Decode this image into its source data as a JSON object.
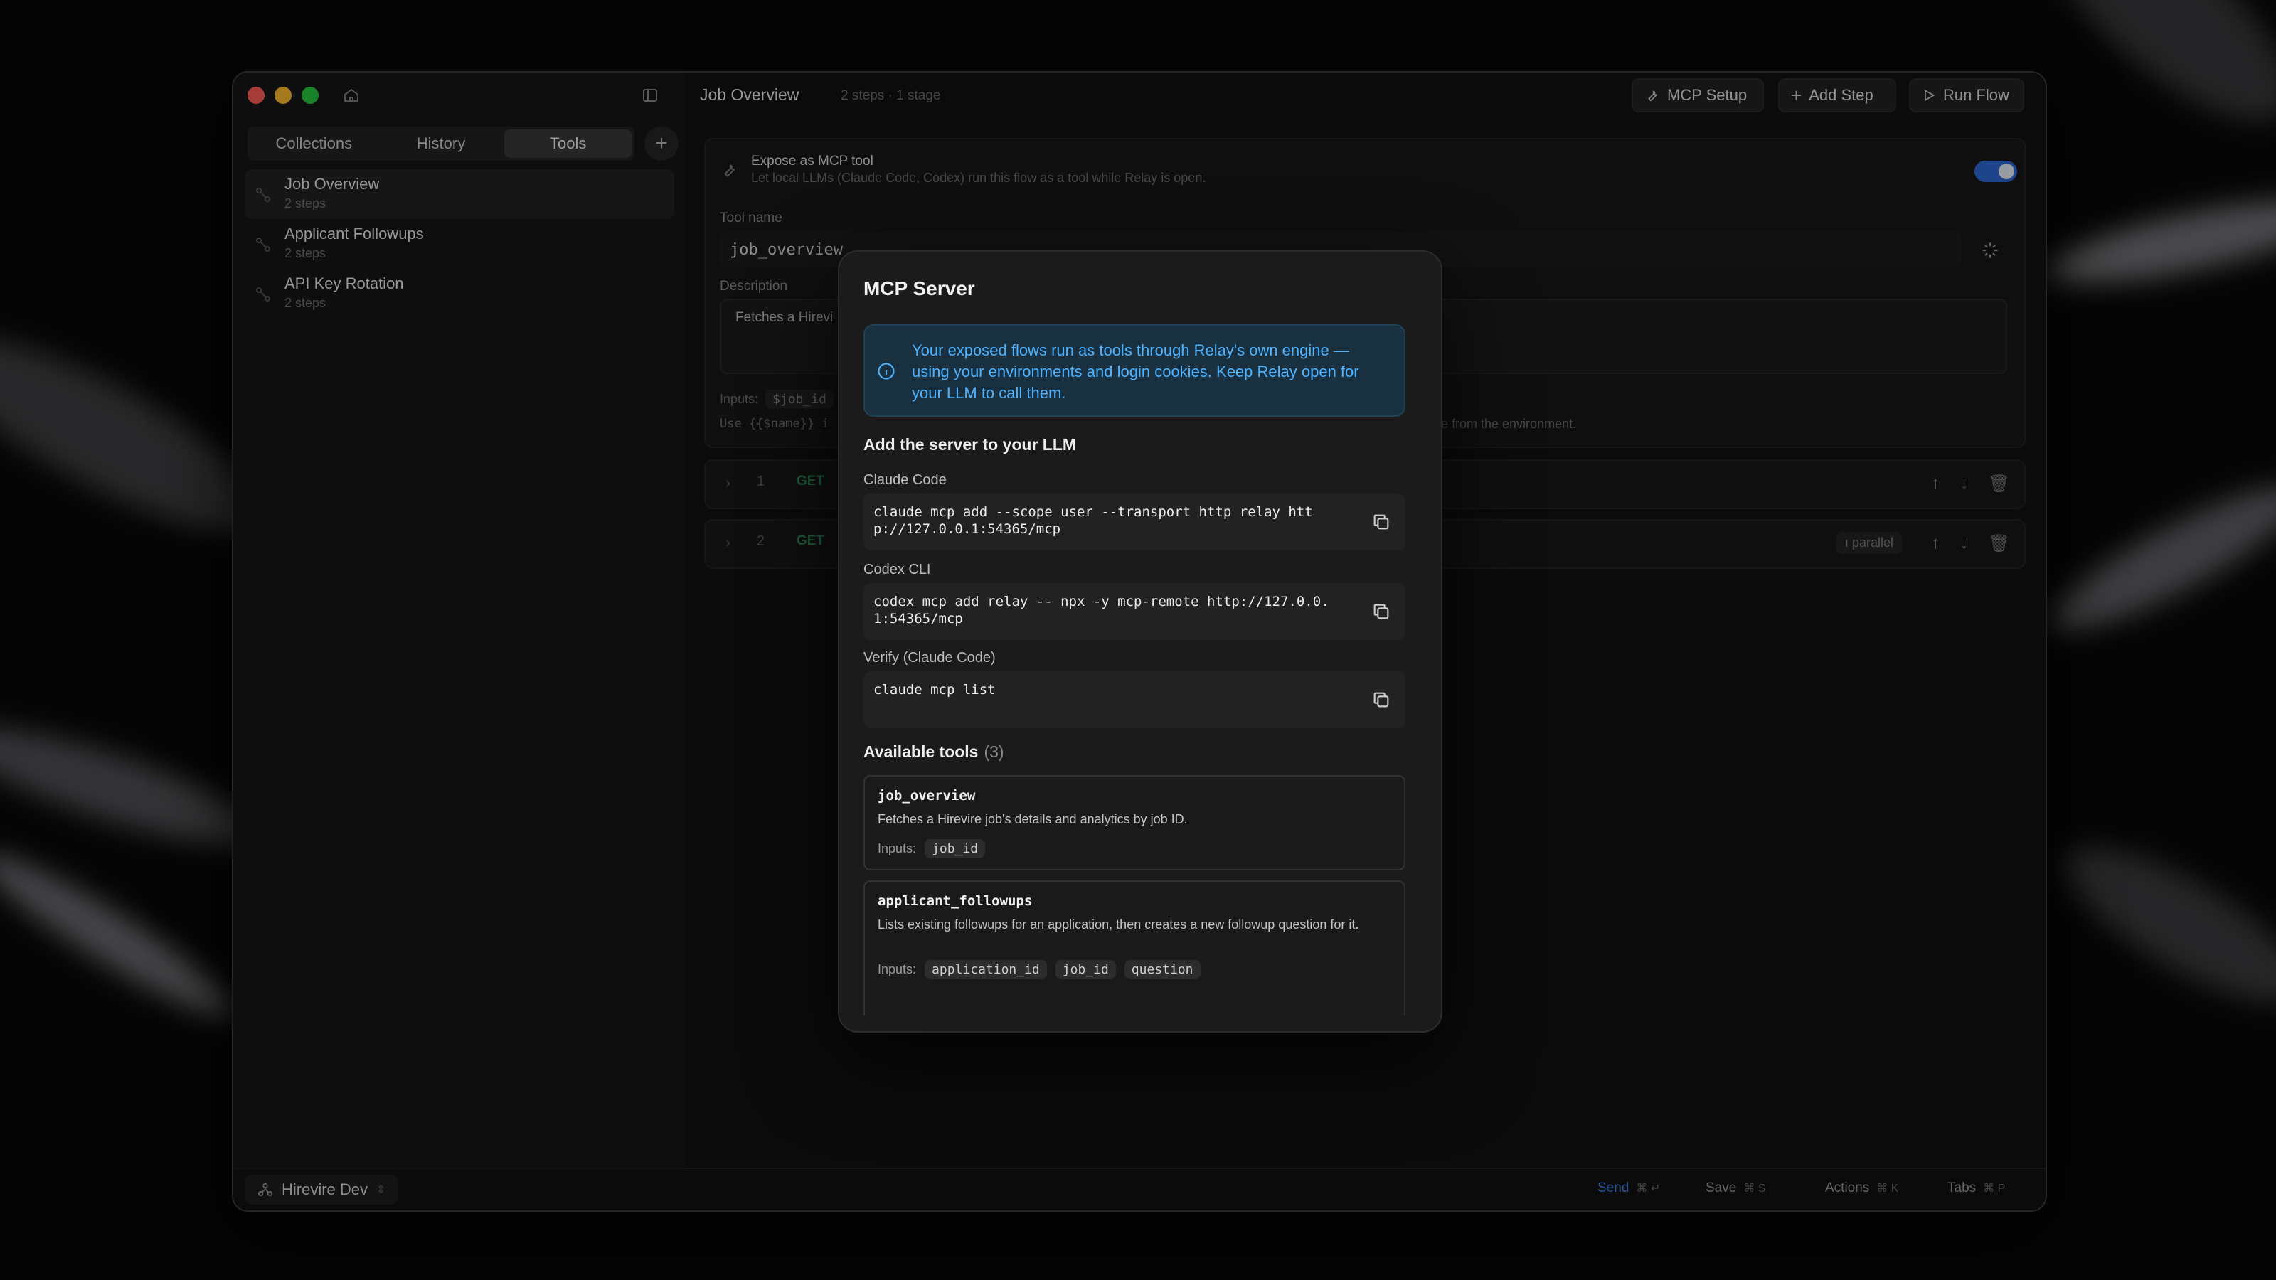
{
  "sidebar": {
    "tabs": [
      {
        "label": "Collections",
        "active": false
      },
      {
        "label": "History",
        "active": false
      },
      {
        "label": "Tools",
        "active": true
      }
    ],
    "add_label": "+",
    "flows": [
      {
        "name": "Job Overview",
        "sub": "2 steps",
        "active": true
      },
      {
        "name": "Applicant Followups",
        "sub": "2 steps",
        "active": false
      },
      {
        "name": "API Key Rotation",
        "sub": "2 steps",
        "active": false
      }
    ]
  },
  "topbar": {
    "title": "Job Overview",
    "meta": "2 steps · 1 stage",
    "buttons": {
      "mcp_setup": "MCP Setup",
      "add_step": "Add Step",
      "run_flow": "Run Flow"
    }
  },
  "expose_card": {
    "title": "Expose as MCP tool",
    "subtitle": "Let local LLMs (Claude Code, Codex) run this flow as a tool while Relay is open.",
    "toggle_on": true,
    "tool_name_label": "Tool name",
    "tool_name_value": "job_overview",
    "description_label": "Description",
    "description_value": "Fetches a Hirevi",
    "inputs_label": "Inputs:",
    "inputs_chip": "$job_id",
    "hint_left": "Use {{$name}} i",
    "hint_right": "e from the environment."
  },
  "steps": [
    {
      "num": "1",
      "method": "GET",
      "badge": ""
    },
    {
      "num": "2",
      "method": "GET",
      "badge": "ı parallel"
    }
  ],
  "modal": {
    "title": "MCP Server",
    "info": "Your exposed flows run as tools through Relay's own engine — using your environments and login cookies. Keep Relay open for your LLM to call them.",
    "add_heading": "Add the server to your LLM",
    "claude_label": "Claude Code",
    "claude_cmd": "claude mcp add --scope user --transport http relay http://127.0.0.1:54365/mcp",
    "codex_label": "Codex CLI",
    "codex_cmd": "codex mcp add relay -- npx -y mcp-remote http://127.0.0.1:54365/mcp",
    "verify_label": "Verify (Claude Code)",
    "verify_cmd": "claude mcp list",
    "tools_heading": "Available tools",
    "tools_count": "(3)",
    "tools": [
      {
        "name": "job_overview",
        "desc": "Fetches a Hirevire job's details and analytics by job ID.",
        "inputs_label": "Inputs:",
        "inputs": [
          "job_id"
        ]
      },
      {
        "name": "applicant_followups",
        "desc": "Lists existing followups for an application, then creates a new followup question for it.",
        "inputs_label": "Inputs:",
        "inputs": [
          "application_id",
          "job_id",
          "question"
        ]
      }
    ]
  },
  "statusbar": {
    "environment": "Hirevire Dev",
    "shortcuts": [
      {
        "label": "Send",
        "keys": "⌘ ↵",
        "accent": true
      },
      {
        "label": "Save",
        "keys": "⌘ S",
        "accent": false
      },
      {
        "label": "Actions",
        "keys": "⌘ K",
        "accent": false
      },
      {
        "label": "Tabs",
        "keys": "⌘ P",
        "accent": false
      }
    ]
  },
  "colors": {
    "accent": "#2f6bd8",
    "info_text": "#4fb3ff",
    "send": "#3d7fe0"
  }
}
